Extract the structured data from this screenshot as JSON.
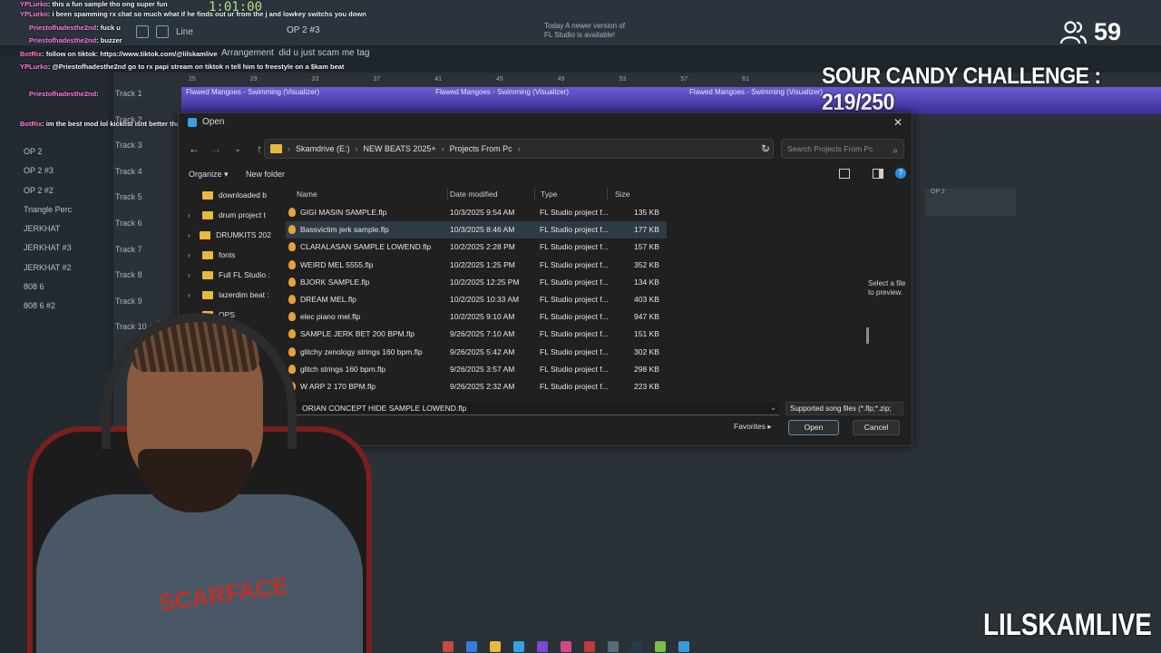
{
  "fl": {
    "tempo": "1:01:00",
    "pattern": "OP 2 #3",
    "line_mode": "Line",
    "arrangement": "Arrangement",
    "arrangement_msg": "did u just scam me tag",
    "news": "Today  A newer version of FL Studio is available!",
    "ruler": [
      "25",
      "29",
      "33",
      "37",
      "41",
      "45",
      "49",
      "53",
      "57",
      "61"
    ],
    "clip_label": "Flawed Mangoes - Swimming (Visualizer)",
    "tracks": [
      "Track 1",
      "Track 2",
      "Track 3",
      "Track 4",
      "Track 5",
      "Track 6",
      "Track 7",
      "Track 8",
      "Track 9",
      "Track 10"
    ],
    "channels": [
      "OP 2",
      "OP 2 #3",
      "OP 2 #2",
      "Triangle Perc",
      "JERKHAT",
      "JERKHAT #3",
      "JERKHAT #2",
      "808 6",
      "808 6 #2"
    ],
    "right_clip": "OP 2"
  },
  "chat": [
    {
      "user": "YPLurko",
      "text": "this a fun sample tho ong super fun"
    },
    {
      "user": "YPLurko",
      "text": "i been spamming rx chat so much what if he finds out ur from the j and lowkey switchs you down"
    },
    {
      "user": "Priestofhadesthe2nd",
      "text": "fuck u"
    },
    {
      "user": "Priestofhadesthe2nd",
      "text": "buzzer"
    },
    {
      "user": "BotRix",
      "text": "follow on tiktok: https://www.tiktok.com/@lilskamlive"
    },
    {
      "user": "YPLurko",
      "text": "@Priestofhadesthe2nd go to rx papi stream on tiktok n tell him to freestyle on a $kam beat"
    },
    {
      "user": "Priestofhadesthe2nd",
      "text": ""
    },
    {
      "user": "BotRix",
      "text": "im the best mod lol kicklist isnt better than me"
    }
  ],
  "overlay": {
    "viewers": "59",
    "challenge": "SOUR CANDY CHALLENGE : 219/250",
    "brand": "LILSKAMLIVE"
  },
  "dialog": {
    "title": "Open",
    "breadcrumb": [
      "Skamdrive (E:)",
      "NEW BEATS 2025+",
      "Projects From Pc"
    ],
    "search_placeholder": "Search Projects From Pc",
    "organize": "Organize",
    "new_folder": "New folder",
    "nav_items": [
      "downloaded b",
      "drum project t",
      "DRUMKITS 202",
      "fonts",
      "Full FL Studio :",
      "lazerdim beat :",
      "OPS"
    ],
    "columns": {
      "name": "Name",
      "date": "Date modified",
      "type": "Type",
      "size": "Size"
    },
    "files": [
      {
        "name": "GIGI MASIN SAMPLE.flp",
        "date": "10/3/2025 9:54 AM",
        "type": "FL Studio project f...",
        "size": "135 KB"
      },
      {
        "name": "Bassvictim jerk sample.flp",
        "date": "10/3/2025 8:46 AM",
        "type": "FL Studio project f...",
        "size": "177 KB"
      },
      {
        "name": "CLARALASAN SAMPLE LOWEND.flp",
        "date": "10/2/2025 2:28 PM",
        "type": "FL Studio project f...",
        "size": "157 KB"
      },
      {
        "name": "WEIRD MEL 5555.flp",
        "date": "10/2/2025 1:25 PM",
        "type": "FL Studio project f...",
        "size": "352 KB"
      },
      {
        "name": "BJORK SAMPLE.flp",
        "date": "10/2/2025 12:25 PM",
        "type": "FL Studio project f...",
        "size": "134 KB"
      },
      {
        "name": "DREAM MEL.flp",
        "date": "10/2/2025 10:33 AM",
        "type": "FL Studio project f...",
        "size": "403 KB"
      },
      {
        "name": "elec piano mel.flp",
        "date": "10/2/2025 9:10 AM",
        "type": "FL Studio project f...",
        "size": "947 KB"
      },
      {
        "name": "SAMPLE JERK BET 200 BPM.flp",
        "date": "9/26/2025 7:10 AM",
        "type": "FL Studio project f...",
        "size": "151 KB"
      },
      {
        "name": "glitchy zenology strings 160 bpm.flp",
        "date": "9/26/2025 5:42 AM",
        "type": "FL Studio project f...",
        "size": "302 KB"
      },
      {
        "name": "glitch strings 160 bpm.flp",
        "date": "9/26/2025 3:57 AM",
        "type": "FL Studio project f...",
        "size": "298 KB"
      },
      {
        "name": "W ARP 2 170 BPM.flp",
        "date": "9/26/2025 2:32 AM",
        "type": "FL Studio project f...",
        "size": "223 KB"
      }
    ],
    "preview_text": "Select a file to preview.",
    "file_name_value": "ORIAN CONCEPT HIDE SAMPLE LOWEND.flp",
    "file_type": "Supported song files (*.flp;*.zip;",
    "favorites": "Favorites",
    "open_button": "Open",
    "cancel_button": "Cancel"
  },
  "webcam": {
    "hoodie_text": "SCARFACE"
  },
  "colors": {
    "accent": "#2a8ee0",
    "folder": "#e8b93c",
    "overlay_text": "#ffffff"
  }
}
